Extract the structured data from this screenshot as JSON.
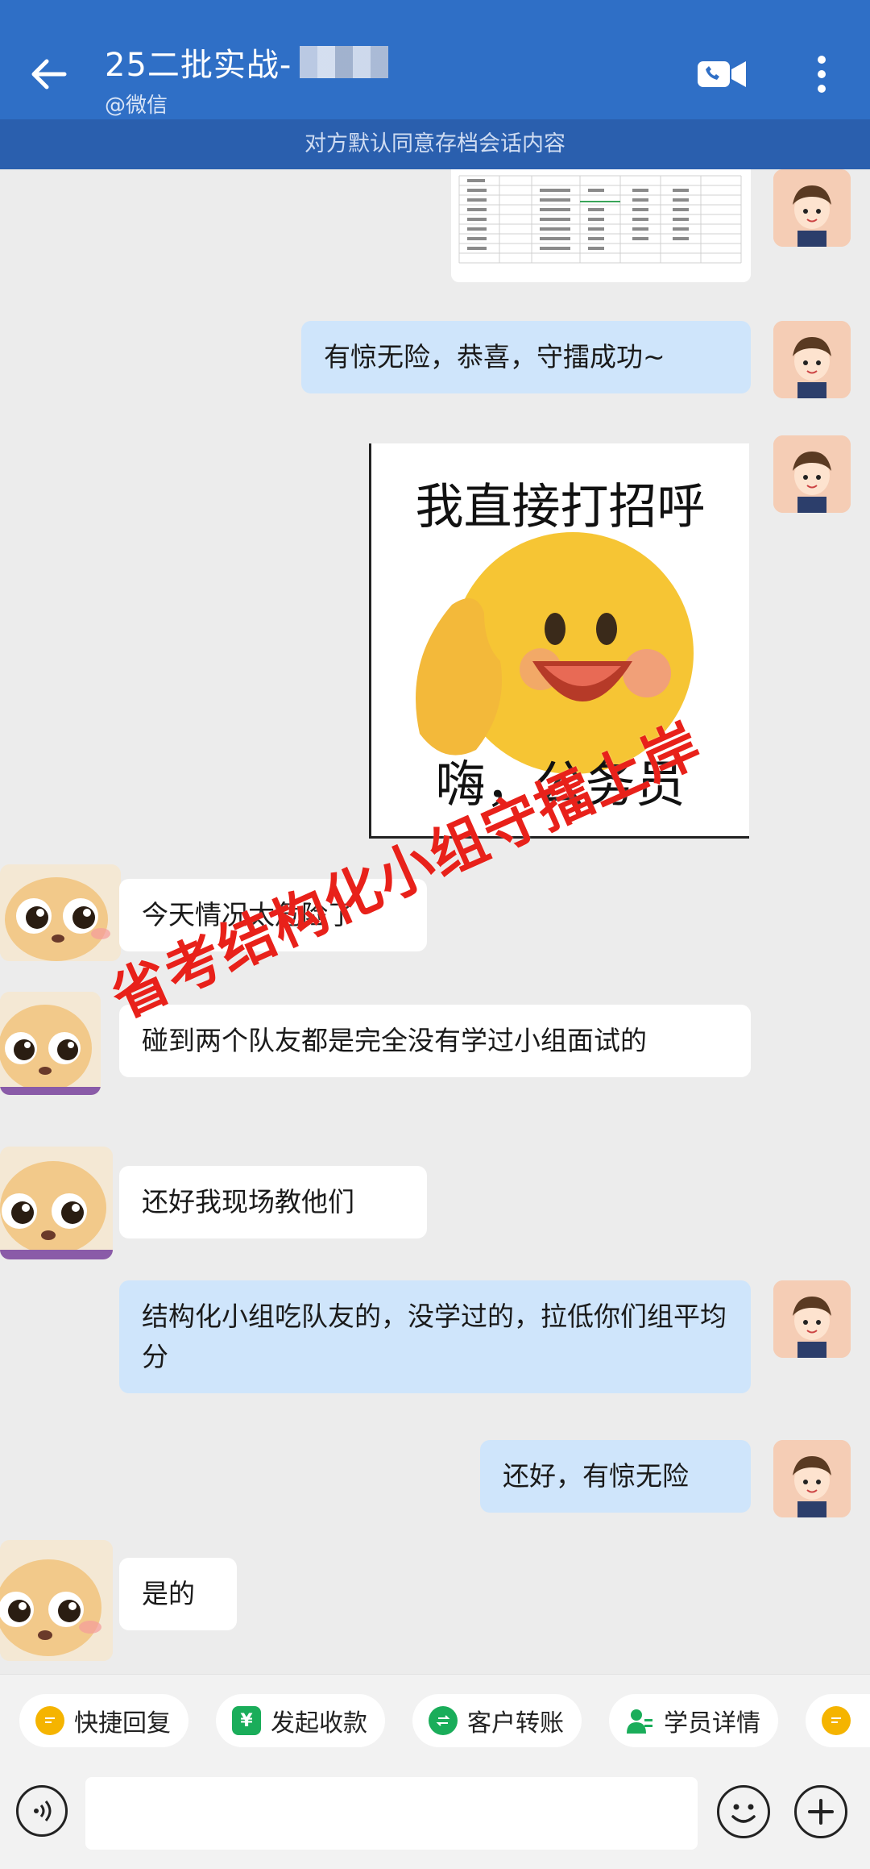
{
  "header": {
    "title": "25二批实战-",
    "subtitle": "@微信"
  },
  "notice": "对方默认同意存档会话内容",
  "messages": [
    {
      "side": "self",
      "type": "image",
      "content": "spreadsheet-screenshot"
    },
    {
      "side": "self",
      "type": "text",
      "text": "有惊无险，恭喜，守擂成功~"
    },
    {
      "side": "self",
      "type": "sticker",
      "top_text": "我直接打招呼",
      "bottom_text": "嗨，公务员"
    },
    {
      "side": "other",
      "type": "text",
      "text": "今天情况太危险了"
    },
    {
      "side": "other",
      "type": "text",
      "text": "碰到两个队友都是完全没有学过小组面试的"
    },
    {
      "side": "other",
      "type": "text",
      "text": "还好我现场教他们"
    },
    {
      "side": "self",
      "type": "text",
      "text": "结构化小组吃队友的，没学过的，拉低你们组平均分"
    },
    {
      "side": "self",
      "type": "text",
      "text": "还好，有惊无险"
    },
    {
      "side": "other",
      "type": "text",
      "text": "是的"
    }
  ],
  "watermark": "省考结构化小组守擂上岸",
  "quick_actions": [
    {
      "label": "快捷回复",
      "icon": "quick-reply-icon",
      "color": "#f5b400"
    },
    {
      "label": "发起收款",
      "icon": "yuan-icon",
      "color": "#1aad5a"
    },
    {
      "label": "客户转账",
      "icon": "transfer-icon",
      "color": "#1aad5a"
    },
    {
      "label": "学员详情",
      "icon": "student-icon",
      "color": "#1aad5a"
    },
    {
      "label": "",
      "icon": "chat-icon",
      "color": "#f5b400"
    }
  ],
  "input": {
    "value": ""
  }
}
